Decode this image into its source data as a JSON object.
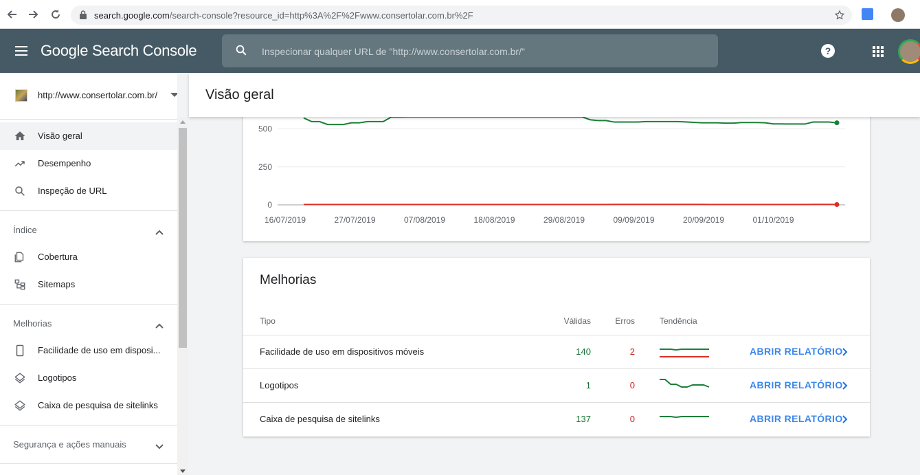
{
  "browser": {
    "url_host": "search.google.com",
    "url_path": "/search-console?resource_id=http%3A%2F%2Fwww.consertolar.com.br%2F"
  },
  "header": {
    "logo": "Google Search Console",
    "search_placeholder": "Inspecionar qualquer URL de \"http://www.consertolar.com.br/\""
  },
  "sidebar": {
    "property": "http://www.consertolar.com.br/",
    "items": [
      {
        "label": "Visão geral",
        "icon": "home-icon"
      },
      {
        "label": "Desempenho",
        "icon": "trending-up-icon"
      },
      {
        "label": "Inspeção de URL",
        "icon": "search-icon"
      }
    ],
    "index_section": "Índice",
    "index_items": [
      {
        "label": "Cobertura",
        "icon": "copy-icon"
      },
      {
        "label": "Sitemaps",
        "icon": "sitemap-icon"
      }
    ],
    "improvements_section": "Melhorias",
    "improvements_items": [
      {
        "label": "Facilidade de uso em disposi...",
        "icon": "smartphone-icon"
      },
      {
        "label": "Logotipos",
        "icon": "layers-icon"
      },
      {
        "label": "Caixa de pesquisa de sitelinks",
        "icon": "layers-icon"
      }
    ],
    "security_section": "Segurança e ações manuais"
  },
  "main": {
    "title": "Visão geral"
  },
  "chart_data": {
    "type": "line",
    "y_ticks": [
      "500",
      "250",
      "0"
    ],
    "ylim": [
      0,
      600
    ],
    "x_ticks": [
      "16/07/2019",
      "27/07/2019",
      "07/08/2019",
      "18/08/2019",
      "29/08/2019",
      "09/09/2019",
      "20/09/2019",
      "01/10/2019"
    ],
    "grid": true,
    "series": [
      {
        "color": "#188038",
        "values": [
          572,
          548,
          548,
          529,
          529,
          529,
          540,
          540,
          548,
          548,
          548,
          578,
          578,
          600,
          600,
          600,
          600,
          600,
          600,
          600,
          600,
          600,
          600,
          600,
          600,
          600,
          600,
          600,
          600,
          600,
          600,
          600,
          600,
          600,
          600,
          600,
          560,
          555,
          555,
          545,
          545,
          545,
          545,
          548,
          548,
          548,
          548,
          548,
          546,
          543,
          540,
          540,
          540,
          538,
          538,
          542,
          542,
          542,
          540,
          533,
          533,
          532,
          532,
          532,
          545,
          545,
          545,
          540
        ]
      },
      {
        "color": "#d93025",
        "values": [
          2,
          2,
          2,
          2,
          2,
          2,
          2,
          2,
          2,
          2,
          2,
          2,
          2,
          2,
          2,
          2,
          2,
          2,
          2,
          2,
          2,
          2,
          2,
          2,
          2,
          2,
          2,
          2,
          2,
          2,
          2,
          2,
          2,
          2,
          2,
          2,
          2,
          2,
          2,
          3,
          3,
          3,
          3,
          3,
          3,
          3,
          3,
          3,
          3,
          3,
          3,
          2,
          2,
          2,
          2,
          2,
          2,
          2,
          2,
          2,
          2,
          2,
          2,
          2,
          3,
          3,
          3,
          2
        ]
      }
    ]
  },
  "improvements": {
    "title": "Melhorias",
    "col_type": "Tipo",
    "col_valid": "Válidas",
    "col_errors": "Erros",
    "col_trend": "Tendência",
    "open_label": "ABRIR RELATÓRIO",
    "rows": [
      {
        "name": "Facilidade de uso em dispositivos móveis",
        "valid": "140",
        "errors": "2",
        "trend_valid": [
          0.7,
          0.7,
          0.7,
          0.65,
          0.7,
          0.7,
          0.7,
          0.7,
          0.7,
          0.7
        ],
        "trend_errors": [
          0.15,
          0.15,
          0.15,
          0.15,
          0.15,
          0.15,
          0.15,
          0.15,
          0.15,
          0.15
        ]
      },
      {
        "name": "Logotipos",
        "valid": "1",
        "errors": "0",
        "trend_valid": [
          0.95,
          0.95,
          0.6,
          0.6,
          0.4,
          0.4,
          0.55,
          0.55,
          0.55,
          0.4
        ],
        "trend_errors": []
      },
      {
        "name": "Caixa de pesquisa de sitelinks",
        "valid": "137",
        "errors": "0",
        "trend_valid": [
          0.7,
          0.7,
          0.7,
          0.65,
          0.7,
          0.7,
          0.7,
          0.7,
          0.7,
          0.7
        ],
        "trend_errors": []
      }
    ]
  }
}
